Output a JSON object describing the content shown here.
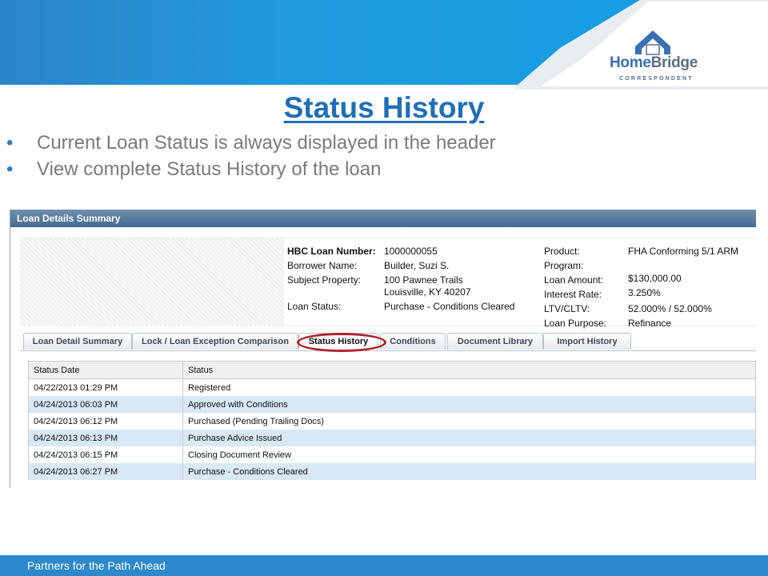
{
  "slide": {
    "title": "Status History",
    "bullets": [
      "Current Loan Status is always displayed in the header",
      "View complete Status History of the loan"
    ],
    "footer": "Partners for the Path Ahead"
  },
  "logo": {
    "word_home": "Home",
    "word_bridge": "Bridge",
    "subtitle": "CORRESPONDENT"
  },
  "colors": {
    "accent_blue": "#1e6fb7",
    "banner_blue": "#1f9be0",
    "highlight_red": "#b1212a",
    "row_stripe": "#d8e8f4"
  },
  "panel": {
    "header": "Loan Details Summary",
    "left_fields": [
      {
        "label": "HBC Loan Number:",
        "value": "1000000055"
      },
      {
        "label": "Borrower Name:",
        "value": "Builder, Suzi S."
      },
      {
        "label": "Subject Property:",
        "value": "100 Pawnee Trails",
        "value2": "Louisville, KY 40207"
      },
      {
        "label": "Loan Status:",
        "value": "Purchase - Conditions Cleared"
      }
    ],
    "right_fields": [
      {
        "label": "Product:",
        "value": "FHA Conforming 5/1 ARM"
      },
      {
        "label": "Program:",
        "value": ""
      },
      {
        "label": "Loan Amount:",
        "value": "$130,000.00"
      },
      {
        "label": "Interest Rate:",
        "value": "3.250%"
      },
      {
        "label": "LTV/CLTV:",
        "value": "52.000% / 52.000%"
      },
      {
        "label": "Loan Purpose:",
        "value": "Refinance"
      }
    ],
    "tabs": [
      "Loan Detail Summary",
      "Lock / Loan Exception Comparison",
      "Status History",
      "Conditions",
      "Document Library",
      "Import History"
    ],
    "active_tab": "Status History",
    "table": {
      "headers": [
        "Status Date",
        "Status"
      ],
      "rows": [
        [
          "04/22/2013 01:29 PM",
          "Registered"
        ],
        [
          "04/24/2013 06:03 PM",
          "Approved with Conditions"
        ],
        [
          "04/24/2013 06:12 PM",
          "Purchased (Pending Trailing Docs)"
        ],
        [
          "04/24/2013 06:13 PM",
          "Purchase Advice Issued"
        ],
        [
          "04/24/2013 06:15 PM",
          "Closing Document Review"
        ],
        [
          "04/24/2013 06:27 PM",
          "Purchase - Conditions Cleared"
        ]
      ]
    }
  }
}
